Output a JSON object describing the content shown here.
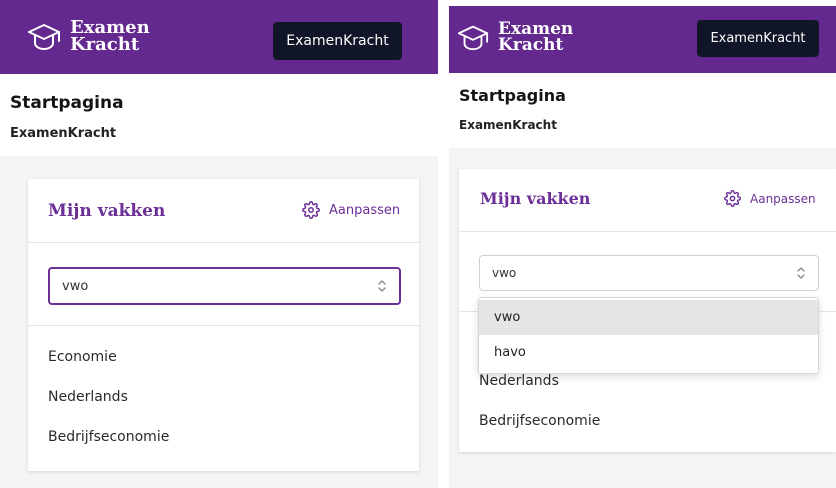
{
  "brand": {
    "line1": "Examen",
    "line2": "Kracht",
    "logo_icon": "graduation-cap-icon"
  },
  "nav_button": "ExamenKracht",
  "page": {
    "title": "Startpagina",
    "subtitle": "ExamenKracht"
  },
  "card": {
    "title": "Mijn vakken",
    "adjust_label": "Aanpassen",
    "adjust_icon": "gear-icon",
    "select_value": "vwo",
    "select_icon": "chevron-up-down-icon"
  },
  "subjects_left": [
    "Economie",
    "Nederlands",
    "Bedrijfseconomie"
  ],
  "subjects_right": [
    "Nederlands",
    "Bedrijfseconomie"
  ],
  "dropdown_options": [
    "vwo",
    "havo"
  ],
  "colors": {
    "brand_purple": "#64298f",
    "accent_purple": "#6b2f96",
    "button_dark": "#101628",
    "background": "#f4f4f6"
  }
}
